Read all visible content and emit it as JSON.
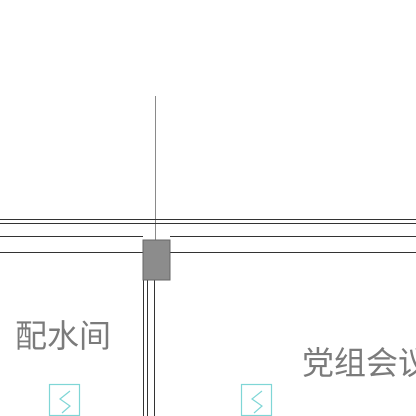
{
  "rooms": [
    {
      "label": "配水间"
    },
    {
      "label": "党组会议"
    }
  ],
  "colors": {
    "background": "#ffffff",
    "wall_line": "#333333",
    "guide_line": "#8a8a8a",
    "column": "#8c8c8c",
    "label": "#7b7b7b",
    "door_symbol": "#7fd6d6"
  },
  "symbols": {
    "door": "door-swing-icon"
  }
}
